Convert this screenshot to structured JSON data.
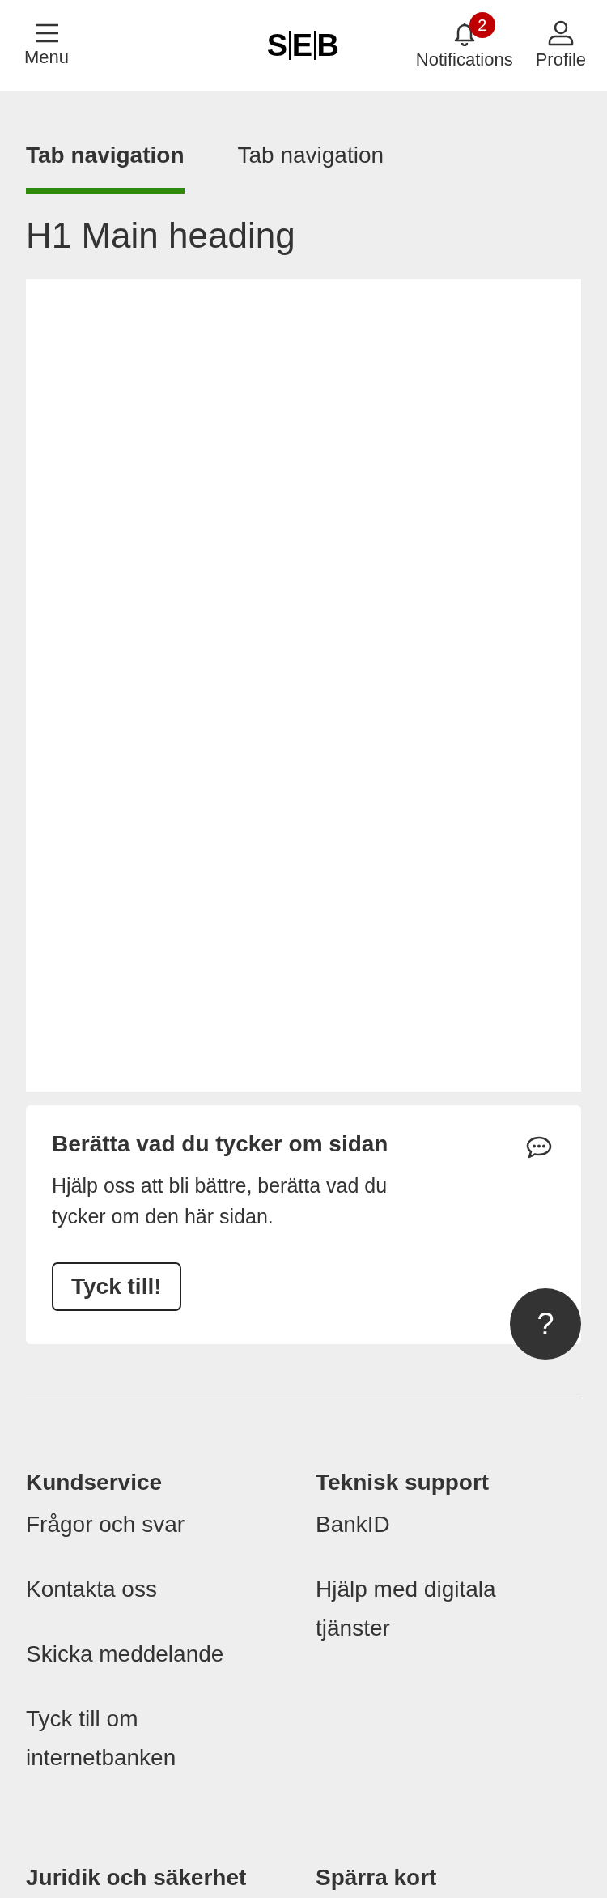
{
  "header": {
    "menu_label": "Menu",
    "logo_letters": [
      "S",
      "E",
      "B"
    ],
    "notifications": {
      "label": "Notifications",
      "badge": "2"
    },
    "profile_label": "Profile"
  },
  "tabs": [
    {
      "label": "Tab navigation",
      "selected": true
    },
    {
      "label": "Tab navigation",
      "selected": false
    }
  ],
  "heading": "H1 Main heading",
  "feedback": {
    "title": "Berätta vad du tycker om sidan",
    "text": "Hjälp oss att bli bättre, berätta vad du tycker om den här sidan.",
    "button": "Tyck till!"
  },
  "help_button": "?",
  "footer": {
    "sections": [
      {
        "heading": "Kundservice",
        "links": [
          "Frågor och svar",
          "Kontakta oss",
          "Skicka meddelande",
          "Tyck till om internetbanken"
        ]
      },
      {
        "heading": "Teknisk support",
        "links": [
          "BankID",
          "Hjälp med digitala tjänster"
        ]
      },
      {
        "heading": "Juridik och säkerhet"
      },
      {
        "heading": "Spärra kort"
      }
    ]
  }
}
